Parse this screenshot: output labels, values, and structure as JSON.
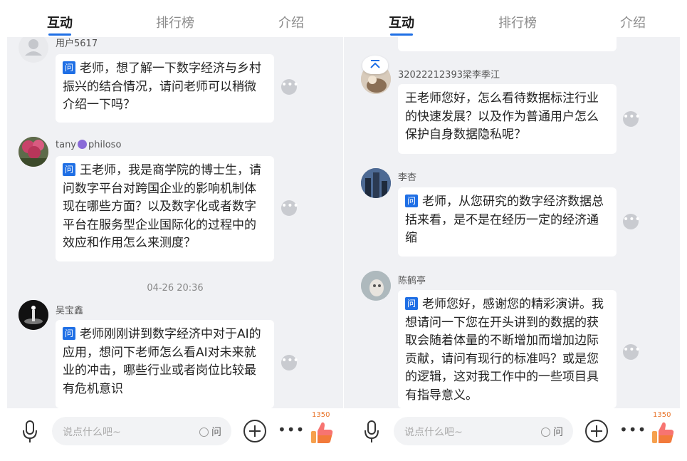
{
  "colors": {
    "accent": "#1f6fe5",
    "feed_bg": "#f0f1f4",
    "like_orange": "#f27a3b"
  },
  "left": {
    "tabs": {
      "interact": "互动",
      "ranking": "排行榜",
      "intro": "介绍"
    },
    "messages": [
      {
        "user": "用户5617",
        "text": "老师，想了解一下数字经济与乡村振兴的结合情况，请问老师可以稍微介绍一下吗？"
      },
      {
        "user": "tany",
        "user_suffix": "philoso",
        "text": "王老师，我是商学院的博士生，请问数字平台对跨国企业的影响机制体现在哪些方面？以及数字化或者数字平台在服务型企业国际化的过程中的效应和作用怎么来测度？"
      },
      {
        "user": "吴宝鑫",
        "text": "老师刚刚讲到数字经济中对于AI的应用，想问下老师怎么看AI对未来就业的冲击，哪些行业或者岗位比较最有危机意识"
      }
    ],
    "time_divider": "04-26 20:36",
    "input": {
      "placeholder": "说点什么吧~",
      "ask_label": "问"
    },
    "like_count": "1350"
  },
  "right": {
    "tabs": {
      "interact": "互动",
      "ranking": "排行榜",
      "intro": "介绍"
    },
    "messages": [
      {
        "user": "32022212393梁李季江",
        "text": "王老师您好，怎么看待数据标注行业的快速发展？以及作为普通用户怎么保护自身数据隐私呢？"
      },
      {
        "user": "李杏",
        "text": "老师，从您研究的数字经济数据总括来看，是不是在经历一定的经济通缩"
      },
      {
        "user": "陈鹤亭",
        "text": "老师您好，感谢您的精彩演讲。我想请问一下您在开头讲到的数据的获取会随着体量的不断增加而增加边际贡献，请问有现行的标准吗？或是您的逻辑，这对我工作中的一些项目具有指导意义。"
      }
    ],
    "input": {
      "placeholder": "说点什么吧~",
      "ask_label": "问"
    },
    "like_count": "1350"
  },
  "badge_label": "问",
  "icons": [
    "default-avatar-icon",
    "scroll-top-icon",
    "mic-icon",
    "plus-icon",
    "more-icon",
    "thumbs-up-icon"
  ]
}
